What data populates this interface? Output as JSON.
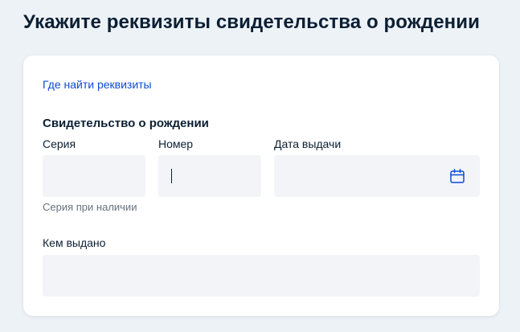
{
  "page": {
    "title": "Укажите реквизиты свидетельства о рождении"
  },
  "form": {
    "help_link": "Где найти реквизиты",
    "section_title": "Свидетельство о рождении",
    "fields": {
      "series": {
        "label": "Серия",
        "value": "",
        "placeholder": "",
        "hint": "Серия при наличии"
      },
      "number": {
        "label": "Номер",
        "value": "",
        "placeholder": "",
        "focused": true
      },
      "issue_date": {
        "label": "Дата выдачи",
        "value": "",
        "placeholder": "",
        "icon": "calendar-icon"
      },
      "issued_by": {
        "label": "Кем выдано",
        "value": "",
        "placeholder": ""
      }
    }
  },
  "colors": {
    "background": "#edf2f7",
    "card": "#ffffff",
    "link": "#0d4cd3",
    "field_background": "#f2f4f8",
    "text": "#0b1f33",
    "hint_text": "#66727f",
    "icon": "#0d4cd3"
  }
}
